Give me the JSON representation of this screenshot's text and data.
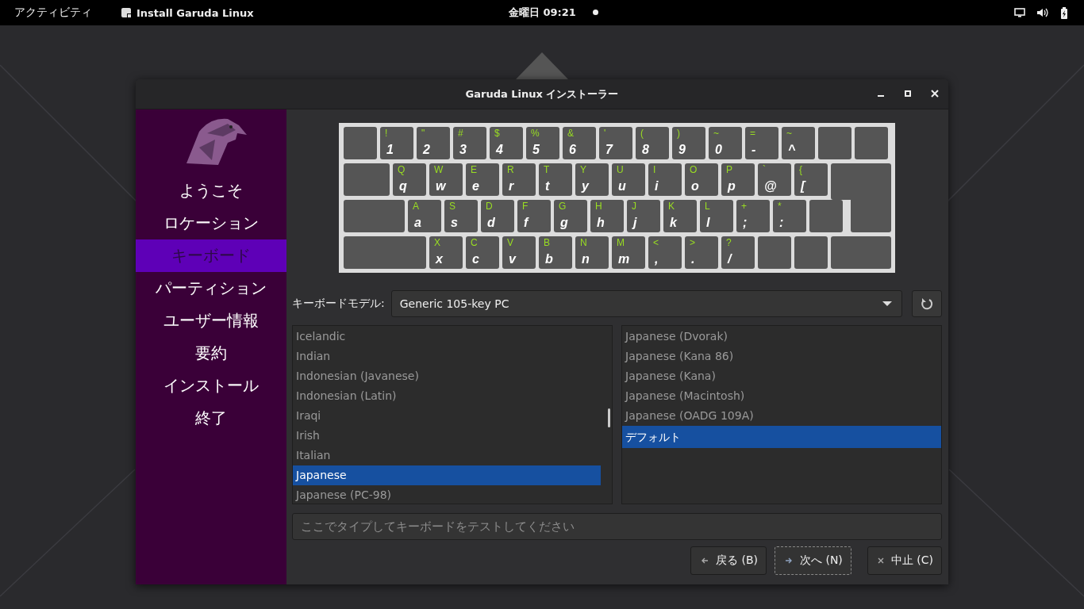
{
  "top_bar": {
    "activities": "アクティビティ",
    "app_name": "Install Garuda Linux",
    "clock": "金曜日 09:21"
  },
  "window": {
    "title": "Garuda Linux インストーラー"
  },
  "sidebar": {
    "items": [
      {
        "label": "ようこそ",
        "selected": false
      },
      {
        "label": "ロケーション",
        "selected": false
      },
      {
        "label": "キーボード",
        "selected": true
      },
      {
        "label": "パーティション",
        "selected": false
      },
      {
        "label": "ユーザー情報",
        "selected": false
      },
      {
        "label": "要約",
        "selected": false
      },
      {
        "label": "インストール",
        "selected": false
      },
      {
        "label": "終了",
        "selected": false
      }
    ]
  },
  "keyboard": {
    "rows": [
      {
        "keys": [
          {
            "kind": "blank"
          },
          {
            "kind": "char",
            "upper": "!",
            "lower": "1"
          },
          {
            "kind": "char",
            "upper": "\"",
            "lower": "2"
          },
          {
            "kind": "char",
            "upper": "#",
            "lower": "3"
          },
          {
            "kind": "char",
            "upper": "$",
            "lower": "4"
          },
          {
            "kind": "char",
            "upper": "%",
            "lower": "5"
          },
          {
            "kind": "char",
            "upper": "&",
            "lower": "6"
          },
          {
            "kind": "char",
            "upper": "'",
            "lower": "7"
          },
          {
            "kind": "char",
            "upper": "(",
            "lower": "8"
          },
          {
            "kind": "char",
            "upper": ")",
            "lower": "9"
          },
          {
            "kind": "char",
            "upper": "~",
            "lower": "0"
          },
          {
            "kind": "char",
            "upper": "=",
            "lower": "-"
          },
          {
            "kind": "char",
            "upper": "~",
            "lower": "^"
          },
          {
            "kind": "blank"
          },
          {
            "kind": "blank"
          }
        ]
      },
      {
        "keys": [
          {
            "kind": "tab"
          },
          {
            "kind": "char",
            "upper": "Q",
            "lower": "q"
          },
          {
            "kind": "char",
            "upper": "W",
            "lower": "w"
          },
          {
            "kind": "char",
            "upper": "E",
            "lower": "e"
          },
          {
            "kind": "char",
            "upper": "R",
            "lower": "r"
          },
          {
            "kind": "char",
            "upper": "T",
            "lower": "t"
          },
          {
            "kind": "char",
            "upper": "Y",
            "lower": "y"
          },
          {
            "kind": "char",
            "upper": "U",
            "lower": "u"
          },
          {
            "kind": "char",
            "upper": "I",
            "lower": "i"
          },
          {
            "kind": "char",
            "upper": "O",
            "lower": "o"
          },
          {
            "kind": "char",
            "upper": "P",
            "lower": "p"
          },
          {
            "kind": "char",
            "upper": "`",
            "lower": "@"
          },
          {
            "kind": "char",
            "upper": "{",
            "lower": "["
          },
          {
            "kind": "enter"
          }
        ]
      },
      {
        "keys": [
          {
            "kind": "caps"
          },
          {
            "kind": "char",
            "upper": "A",
            "lower": "a"
          },
          {
            "kind": "char",
            "upper": "S",
            "lower": "s"
          },
          {
            "kind": "char",
            "upper": "D",
            "lower": "d"
          },
          {
            "kind": "char",
            "upper": "F",
            "lower": "f"
          },
          {
            "kind": "char",
            "upper": "G",
            "lower": "g"
          },
          {
            "kind": "char",
            "upper": "H",
            "lower": "h"
          },
          {
            "kind": "char",
            "upper": "J",
            "lower": "j"
          },
          {
            "kind": "char",
            "upper": "K",
            "lower": "k"
          },
          {
            "kind": "char",
            "upper": "L",
            "lower": "l"
          },
          {
            "kind": "char",
            "upper": "+",
            "lower": ";"
          },
          {
            "kind": "char",
            "upper": "*",
            "lower": ":"
          },
          {
            "kind": "blank"
          },
          {
            "kind": "enter-lower"
          }
        ]
      },
      {
        "keys": [
          {
            "kind": "shift"
          },
          {
            "kind": "char",
            "upper": "X",
            "lower": "x"
          },
          {
            "kind": "char",
            "upper": "C",
            "lower": "c"
          },
          {
            "kind": "char",
            "upper": "V",
            "lower": "v"
          },
          {
            "kind": "char",
            "upper": "B",
            "lower": "b"
          },
          {
            "kind": "char",
            "upper": "N",
            "lower": "n"
          },
          {
            "kind": "char",
            "upper": "M",
            "lower": "m"
          },
          {
            "kind": "char",
            "upper": "<",
            "lower": ","
          },
          {
            "kind": "char",
            "upper": ">",
            "lower": "."
          },
          {
            "kind": "char",
            "upper": "?",
            "lower": "/"
          },
          {
            "kind": "blank"
          },
          {
            "kind": "blank"
          },
          {
            "kind": "wide"
          }
        ]
      }
    ]
  },
  "model": {
    "label": "キーボードモデル:",
    "value": "Generic 105-key PC"
  },
  "layouts": [
    {
      "label": "Icelandic",
      "selected": false
    },
    {
      "label": "Indian",
      "selected": false
    },
    {
      "label": "Indonesian (Javanese)",
      "selected": false
    },
    {
      "label": "Indonesian (Latin)",
      "selected": false
    },
    {
      "label": "Iraqi",
      "selected": false
    },
    {
      "label": "Irish",
      "selected": false
    },
    {
      "label": "Italian",
      "selected": false
    },
    {
      "label": "Japanese",
      "selected": true
    },
    {
      "label": "Japanese (PC-98)",
      "selected": false
    }
  ],
  "variants": [
    {
      "label": "Japanese (Dvorak)",
      "selected": false
    },
    {
      "label": "Japanese (Kana 86)",
      "selected": false
    },
    {
      "label": "Japanese (Kana)",
      "selected": false
    },
    {
      "label": "Japanese (Macintosh)",
      "selected": false
    },
    {
      "label": "Japanese (OADG 109A)",
      "selected": false
    },
    {
      "label": "デフォルト",
      "selected": true
    }
  ],
  "test_field": {
    "placeholder": "ここでタイプしてキーボードをテストしてください"
  },
  "buttons": [
    {
      "label": "戻る (B)",
      "kind": "back",
      "focused": false
    },
    {
      "label": "次へ (N)",
      "kind": "next",
      "focused": true
    },
    {
      "label": "中止 (C)",
      "kind": "cancel",
      "focused": false
    }
  ]
}
